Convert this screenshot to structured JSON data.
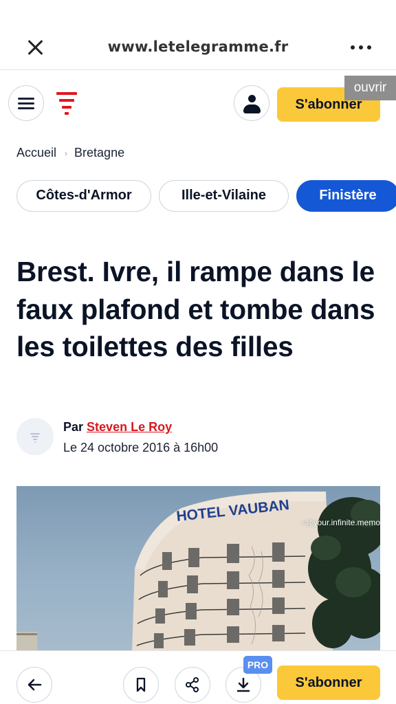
{
  "browser": {
    "url": "www.letelegramme.fr"
  },
  "header": {
    "subscribe_label": "S'abonner",
    "open_badge": "ouvrir"
  },
  "breadcrumb": {
    "items": [
      "Accueil",
      "Bretagne"
    ],
    "separator": "›"
  },
  "tags": [
    {
      "label": "Côtes-d'Armor",
      "active": false
    },
    {
      "label": "Ille-et-Vilaine",
      "active": false
    },
    {
      "label": "Finistère",
      "active": true
    }
  ],
  "article": {
    "title": "Brest. Ivre, il rampe dans le faux plafond et tombe dans les toilettes des filles",
    "author_prefix": "Par",
    "author_name": "Steven Le Roy",
    "date": "Le 24 octobre 2016 à 16h00"
  },
  "photo": {
    "hotel_sign": "HOTEL VAUBAN",
    "watermark": "♪@your.infinite.memory"
  },
  "bottom_bar": {
    "pro_badge": "PRO",
    "subscribe_label": "S'abonner"
  },
  "colors": {
    "accent_yellow": "#fbc83a",
    "active_tag_blue": "#1558d6",
    "brand_red": "#e2151d",
    "text_dark": "#0b1426"
  },
  "icons": [
    "close-icon",
    "more-icon",
    "menu-icon",
    "logo-icon",
    "user-icon",
    "back-arrow-icon",
    "bookmark-icon",
    "share-icon",
    "download-icon"
  ]
}
